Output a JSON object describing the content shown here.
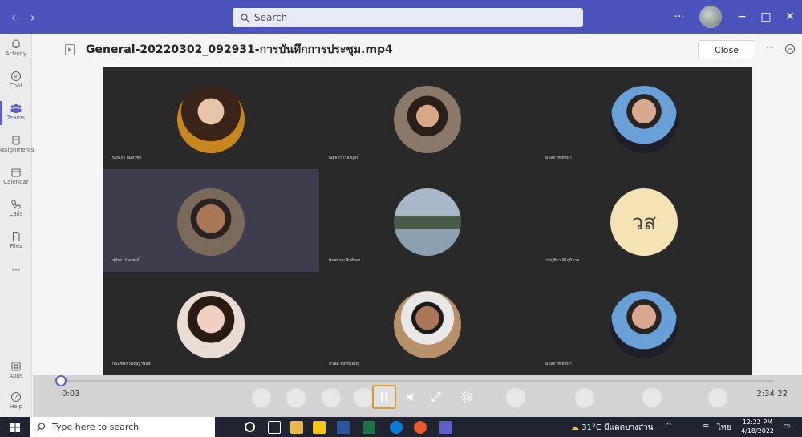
{
  "titlebar": {
    "search_placeholder": "Search",
    "more": "···",
    "minimize": "−",
    "maximize": "□",
    "close": "✕"
  },
  "rail": {
    "items": [
      {
        "label": "Activity"
      },
      {
        "label": "Chat"
      },
      {
        "label": "Teams"
      },
      {
        "label": "Assignments"
      },
      {
        "label": "Calendar"
      },
      {
        "label": "Calls"
      },
      {
        "label": "Files"
      },
      {
        "label": "Apps"
      },
      {
        "label": "Help"
      }
    ],
    "more": "···"
  },
  "file": {
    "title": "General-20220302_092931-การบันทึกการประชุม.mp4",
    "close_label": "Close",
    "more": "···"
  },
  "video": {
    "initials_tile": "วส",
    "participants": [
      {
        "name": "ปวีณรา กมลวิชิต",
        "color": "#6b4a36"
      },
      {
        "name": "ณัฐธิดา เรืองฤทธิ์",
        "color": "#5a5048"
      },
      {
        "name": "มาลัย ทิพย์พนา",
        "color": "#3d6fa8"
      },
      {
        "name": "สุภัทร ปาลวัฒน์",
        "color": "#2e2a28"
      },
      {
        "name": "พิมพรรณ สิงห์ทอง",
        "color": "#7a8e9e"
      },
      {
        "name": "วรัญชิดา สิริภูมิภาค",
        "color": "#f6e3b5"
      },
      {
        "name": "กมลชนก ปริญญาพันธ์",
        "color": "#d8b8a8"
      },
      {
        "name": "ชวลิต จันทร์เจริญ",
        "color": "#8a6d4a"
      },
      {
        "name": "มาลัย ทิพย์พนา",
        "color": "#3d6fa8"
      }
    ]
  },
  "player": {
    "current_time": "0:03",
    "total_time": "2:34:22",
    "progress": 0.0
  },
  "taskbar": {
    "search_placeholder": "Type here to search",
    "weather": "31°C มีแดดบางส่วน",
    "lang": "ไทย",
    "time": "12:22 PM",
    "date": "4/18/2022"
  }
}
